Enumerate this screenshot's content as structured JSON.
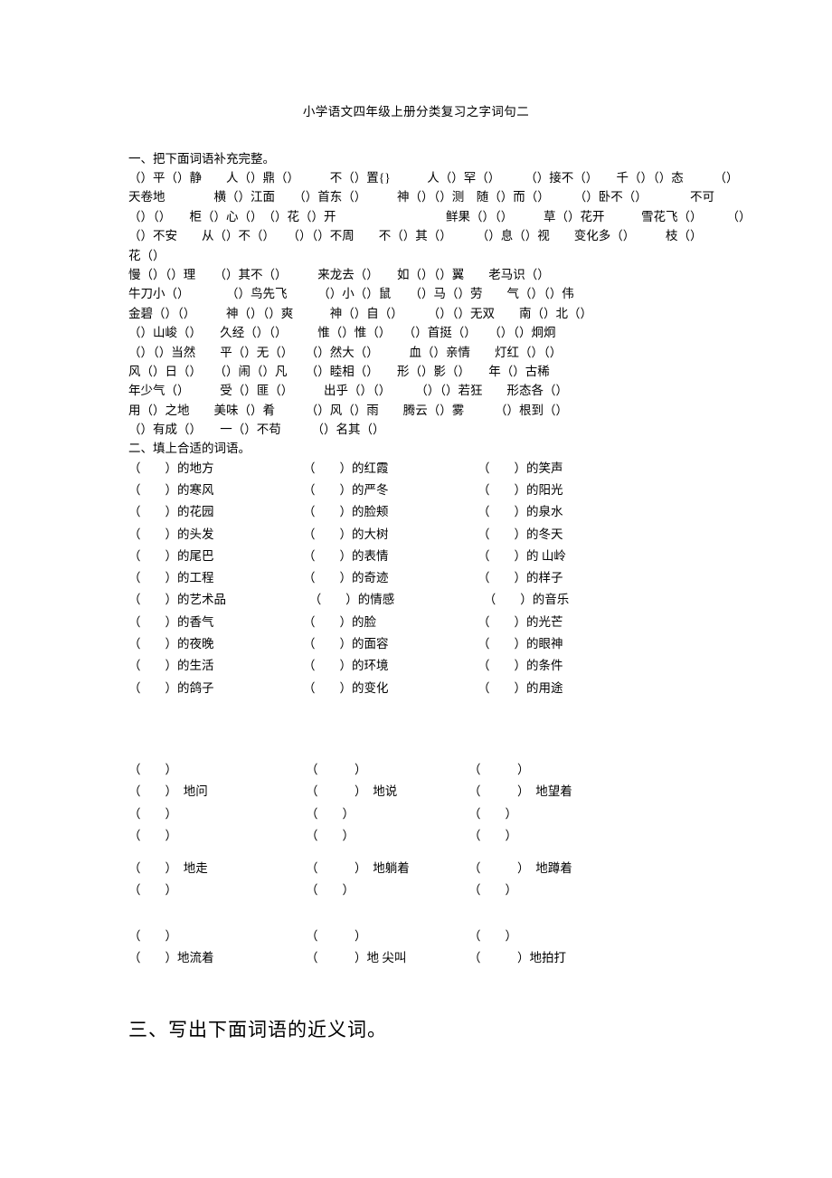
{
  "document": {
    "title": "小学语文四年级上册分类复习之字词句二"
  },
  "section1": {
    "heading": "一、把下面词语补充完整。",
    "lines": [
      "（）平（）静　　人（）鼎（）　　　不（）置{}　　　人（）罕（）　　　（）接不（）　　千（）（）态　　　（）",
      "天卷地　　　　横（）江面　　（）首东（）　　　神（）（）测　随（）而（）　　　（）卧不（）　　　　不可",
      "（）（）　　柜（）心（）　（）花（）开　　　　　　　　　鲜果（）（）　　　草（）花开　　　雪花飞（）　　　（）",
      "（）不安　　从（）不（）　　（）（）不周　　不（）其（）　　　（）息（）视　　变化多（）　　　枝（）",
      "花（）",
      "慢（）（）理　　（）其不（）　　　来龙去（）　　如（）（）翼　　老马识（）",
      "牛刀小（）　　　　（）鸟先飞　　　（）小（）鼠　　（）马（）劳　　气（）（）伟",
      "金碧（）（）　　　神（）（）爽　　　神（）自（）　　　（）（）无双　　南（）北（）",
      "（）山峻（）　　久经（）（）　　　惟（）惟（）　　（）首挺（）　　（）（）炯炯",
      "（）（）当然　　平（）无（）　　（）然大（）　　　血（）亲情　　灯红（）（）",
      "风（）日（）　　（）闹（）凡　　（）睦相（）　　形（）影（）　　年（）古稀",
      "年少气（）　　　受（）匪（）　　　出乎（）（）　　　（）（）若狂　　形态各（）",
      "用（）之地　　美味（）肴　　　（）风（）雨　　腾云（）雾　　　（）根到（）",
      "（）有成（）　　一（）不苟　　　（）名其（）"
    ]
  },
  "section2": {
    "heading": "二、填上合适的词语。",
    "rows": [
      [
        "（　　）的地方",
        "（　　）的红霞",
        "（　　）的笑声"
      ],
      [
        "（　　）的寒风",
        "（　　）的严冬",
        "（　　）的阳光"
      ],
      [
        "（　　）的花园",
        "（　　）的脸颊",
        "（　　）的泉水"
      ],
      [
        "（　　）的头发",
        "（　　）的大树",
        "（　　）的冬天"
      ],
      [
        "（　　）的尾巴",
        "（　　）的表情",
        "（　　）的 山岭"
      ],
      [
        "（　　）的工程",
        "（　　）的奇迹",
        "（　　）的样子"
      ],
      [
        "（　　）的艺术品",
        "　（　　）的情感",
        "　（　　）的音乐"
      ],
      [
        "（　　）的香气",
        "（　　）的脸",
        "（　　）的光芒"
      ],
      [
        "（　　）的夜晚",
        "（　　）的面容",
        "（　　）的眼神"
      ],
      [
        "（　　）的生活",
        "（　　）的环境",
        "（　　）的条件"
      ],
      [
        "（　　）的鸽子",
        "（　　）的变化",
        "（　　）的用途"
      ]
    ]
  },
  "section3": {
    "group1": {
      "rows": [
        [
          "（　　）",
          "（　　　）",
          "（　　　）"
        ],
        [
          "（　　）　地问",
          "（　　　）　地说",
          "（　　　）　地望着"
        ],
        [
          "（　　）",
          "（　　）",
          "（　　）"
        ],
        [
          "（　　）",
          "（　　）",
          "（　　）"
        ]
      ]
    },
    "group2": {
      "rows": [
        [
          "（　　）　地走",
          "（　　　）　地躺着",
          "（　　　）　地蹲着"
        ],
        [
          "（　　）",
          "（　　）",
          "（　　）"
        ]
      ]
    },
    "group3": {
      "rows": [
        [
          "（　　）",
          "（　　　）",
          "（　　）"
        ],
        [
          "（　　）地流着",
          "（　　　）地 尖叫",
          "（　　　）地拍打"
        ]
      ]
    }
  },
  "section4": {
    "heading": "三、写出下面词语的近义词。"
  }
}
